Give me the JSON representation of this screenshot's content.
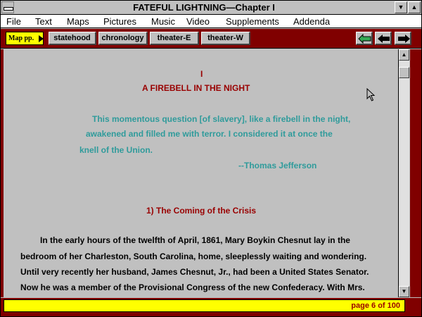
{
  "window": {
    "title": "FATEFUL LIGHTNING—Chapter I",
    "minimize_glyph": "▼",
    "maximize_glyph": "▲"
  },
  "menu": {
    "items": [
      "File",
      "Text",
      "Maps",
      "Pictures",
      "Music",
      "Video",
      "Supplements",
      "Addenda"
    ]
  },
  "toolbar": {
    "map_label": "Map pp.",
    "tabs": [
      "statehood",
      "chronology",
      "theater-E",
      "theater-W"
    ]
  },
  "content": {
    "chapter_numeral": "I",
    "chapter_title": "A FIREBELL IN THE NIGHT",
    "quote_lines": [
      "This momentous question [of slavery], like a firebell in the night,",
      "awakened and filled me with terror.  I  considered it at once the",
      "knell of the Union."
    ],
    "quote_attribution": "--Thomas Jefferson",
    "section_heading": "1)  The Coming of the Crisis",
    "body_lines": [
      "In the early hours of the twelfth of April, 1861, Mary Boykin Chesnut lay in the",
      "bedroom of her Charleston, South Carolina, home, sleeplessly waiting and wondering.",
      "Until very recently her husband, James Chesnut, Jr., had been a United States Senator.",
      "Now he was a member of the Provisional Congress of the new Confederacy.  With Mrs."
    ]
  },
  "scrollbar": {
    "position_fraction": 0.03,
    "up_glyph": "▲",
    "down_glyph": "▼"
  },
  "status": {
    "page_text": "page 6 of 100"
  },
  "colors": {
    "frame": "#800000",
    "title_red": "#990000",
    "quote_teal": "#2f9b9b",
    "status_yellow": "#ffff00"
  }
}
